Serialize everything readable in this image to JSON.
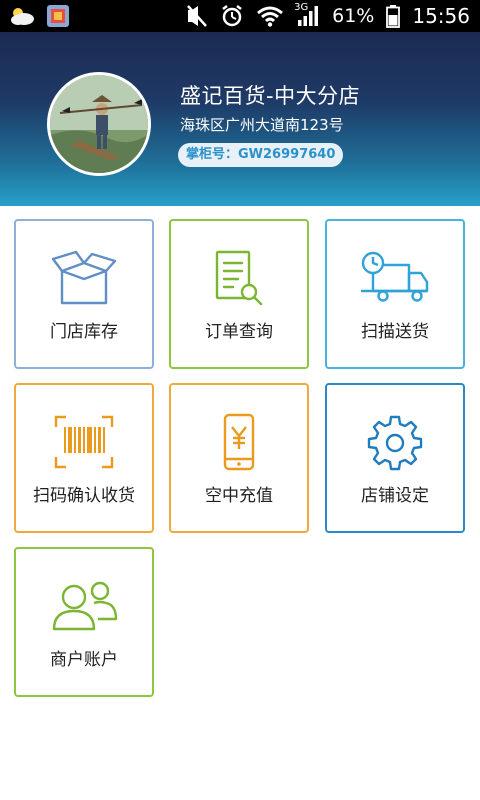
{
  "status_bar": {
    "network": "3G",
    "battery": "61%",
    "time": "15:56",
    "icons": [
      "weather-icon",
      "app-icon",
      "mute-icon",
      "alarm-icon",
      "wifi-icon",
      "signal-icon",
      "battery-icon"
    ]
  },
  "store": {
    "name": "盛记百货-中大分店",
    "address": "海珠区广州大道南123号",
    "cashier": "掌柜号：GW26997640"
  },
  "tiles": [
    {
      "label": "门店库存",
      "icon": "box-icon",
      "color": "#8fb0d6"
    },
    {
      "label": "订单查询",
      "icon": "order-search-icon",
      "color": "#8dc63f"
    },
    {
      "label": "扫描送货",
      "icon": "delivery-truck-icon",
      "color": "#49b3e0"
    },
    {
      "label": "扫码确认收货",
      "icon": "barcode-scan-icon",
      "color": "#f0a93b"
    },
    {
      "label": "空中充值",
      "icon": "phone-recharge-icon",
      "color": "#f0a93b"
    },
    {
      "label": "店铺设定",
      "icon": "gear-icon",
      "color": "#2d88c9"
    },
    {
      "label": "商户账户",
      "icon": "users-icon",
      "color": "#8dc63f"
    }
  ]
}
